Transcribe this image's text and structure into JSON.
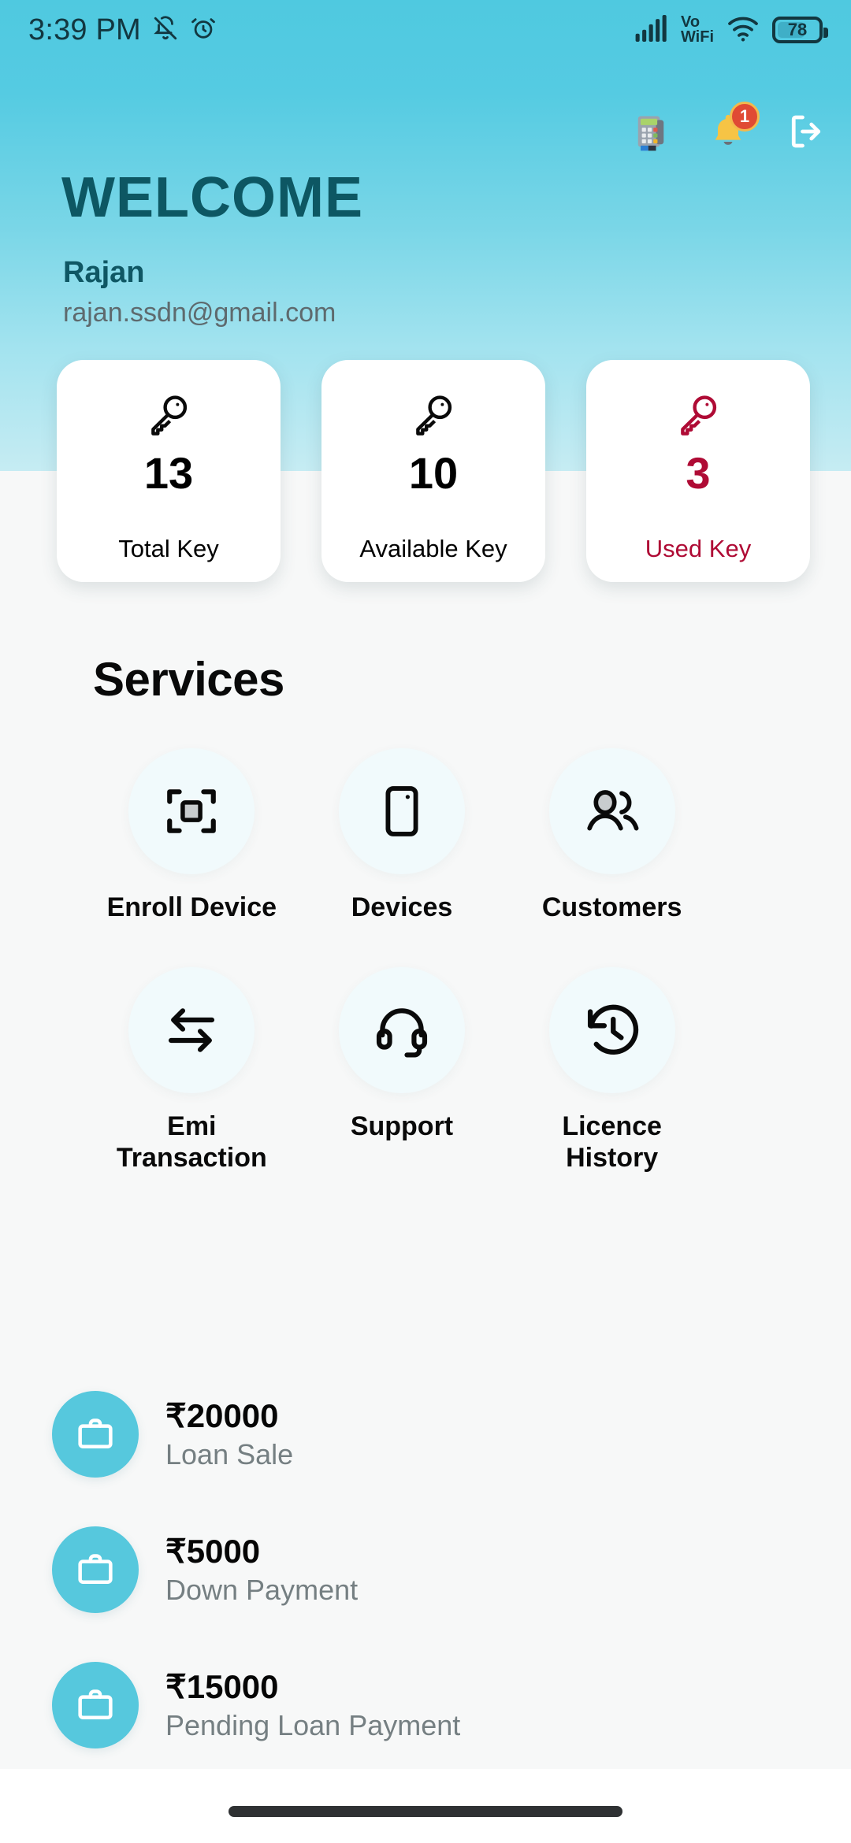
{
  "status_bar": {
    "time": "3:39 PM",
    "icons_left": [
      "mute-bell-icon",
      "alarm-clock-icon"
    ],
    "network_label_top": "Vo",
    "network_label_bottom": "WiFi",
    "battery_level": "78",
    "icons_right": [
      "signal-bars-icon",
      "wifi-icon",
      "battery-icon"
    ]
  },
  "top_actions": {
    "pos_terminal_icon": "pos-terminal-icon",
    "notification_icon": "bell-icon",
    "notification_count": "1",
    "logout_icon": "logout-icon"
  },
  "header": {
    "title": "WELCOME",
    "user_name": "Rajan",
    "user_email": "rajan.ssdn@gmail.com"
  },
  "key_cards": [
    {
      "icon": "key-icon",
      "value": "13",
      "label": "Total Key",
      "color": "#0a0a0a"
    },
    {
      "icon": "key-icon",
      "value": "10",
      "label": "Available Key",
      "color": "#0a0a0a"
    },
    {
      "icon": "key-icon",
      "value": "3",
      "label": "Used Key",
      "color": "#AF0B35"
    }
  ],
  "services": {
    "title": "Services",
    "items": [
      {
        "icon": "scan-device-icon",
        "label": "Enroll Device"
      },
      {
        "icon": "mobile-phone-icon",
        "label": "Devices"
      },
      {
        "icon": "customers-icon",
        "label": "Customers"
      },
      {
        "icon": "transfer-arrows-icon",
        "label": "Emi Transaction"
      },
      {
        "icon": "headset-icon",
        "label": "Support"
      },
      {
        "icon": "history-clock-icon",
        "label": "Licence History"
      }
    ]
  },
  "stats": [
    {
      "icon": "briefcase-icon",
      "amount": "₹20000",
      "label": "Loan Sale"
    },
    {
      "icon": "briefcase-icon",
      "amount": "₹5000",
      "label": "Down Payment"
    },
    {
      "icon": "briefcase-icon",
      "amount": "₹15000",
      "label": "Pending Loan Payment"
    }
  ],
  "theme": {
    "accent": "#4FC9E0",
    "header_text": "#0D5763",
    "danger": "#AF0B35",
    "background": "#F7F8F8",
    "stat_circle": "#56C8DD"
  }
}
